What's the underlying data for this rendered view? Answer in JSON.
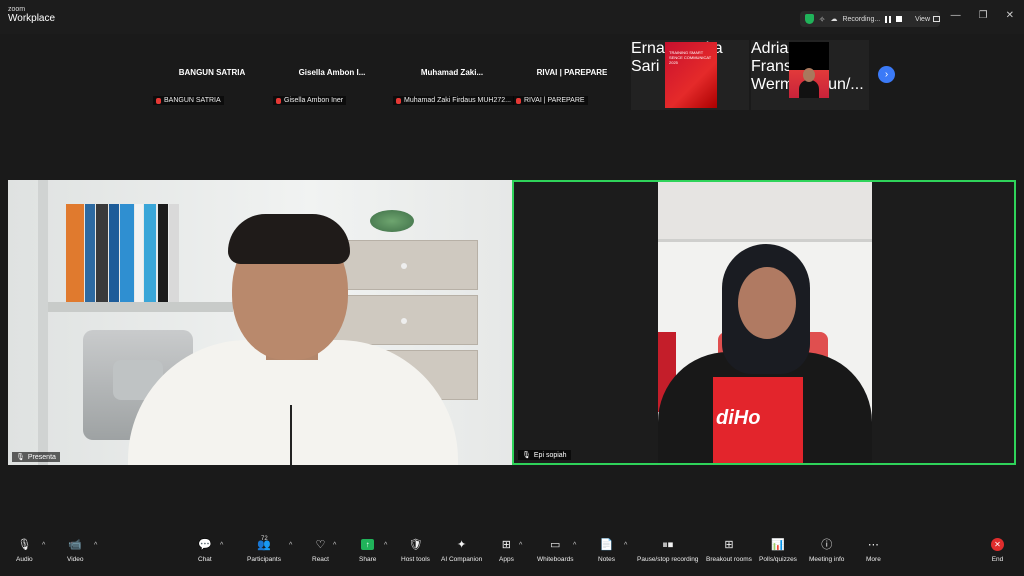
{
  "titlebar": {
    "brand_top": "zoom",
    "brand_bottom": "Workplace",
    "recording_label": "Recording...",
    "view_label": "View",
    "minimize": "—",
    "restore": "❐",
    "close": "✕"
  },
  "gallery": {
    "tiles": [
      {
        "big_name": "BANGUN SATRIA",
        "small_name": "BANGUN SATRIA"
      },
      {
        "big_name": "Gisella Ambon I...",
        "small_name": "Gisella Ambon Iner"
      },
      {
        "big_name": "Muhamad  Zaki...",
        "small_name": "Muhamad Zaki Firdaus MUH272..."
      },
      {
        "big_name": "RIVAI | PAREPARE",
        "small_name": "RIVAI | PAREPARE"
      }
    ],
    "video_tiles": [
      {
        "small_name": "Erna Puspita Sari",
        "slide_text": "TRAINING SMART\nSENCE COMMUNICAT\n2025"
      },
      {
        "small_name": "Adriana Fransiska Wermasubun/..."
      }
    ],
    "next_glyph": "›"
  },
  "stage": {
    "left_name": "Presenta",
    "right_name": "Epi sopiah",
    "shirt_text": "diHo"
  },
  "toolbar": {
    "items": [
      {
        "label": "Audio",
        "icon": "🎙"
      },
      {
        "label": "Video",
        "icon": "📹"
      },
      {
        "label": "Chat",
        "icon": "💬"
      },
      {
        "label": "Participants",
        "icon": "👥",
        "count": "72"
      },
      {
        "label": "React",
        "icon": "♡"
      },
      {
        "label": "Share",
        "icon": "↑"
      },
      {
        "label": "Host tools",
        "icon": "🛡"
      },
      {
        "label": "AI Companion",
        "icon": "✦"
      },
      {
        "label": "Apps",
        "icon": "⊞"
      },
      {
        "label": "Whiteboards",
        "icon": "▭"
      },
      {
        "label": "Notes",
        "icon": "📄"
      },
      {
        "label": "Pause/stop recording",
        "icon": "⏸⏹"
      },
      {
        "label": "Breakout rooms",
        "icon": "⊞"
      },
      {
        "label": "Polls/quizzes",
        "icon": "📊"
      },
      {
        "label": "Meeting info",
        "icon": "ⓘ"
      },
      {
        "label": "More",
        "icon": "⋯"
      },
      {
        "label": "End",
        "icon": "✕"
      }
    ]
  },
  "colors": {
    "active_speaker_border": "#2fd35a",
    "end_red": "#e02d2d",
    "share_green": "#20b35a",
    "next_blue": "#3b7af7"
  }
}
